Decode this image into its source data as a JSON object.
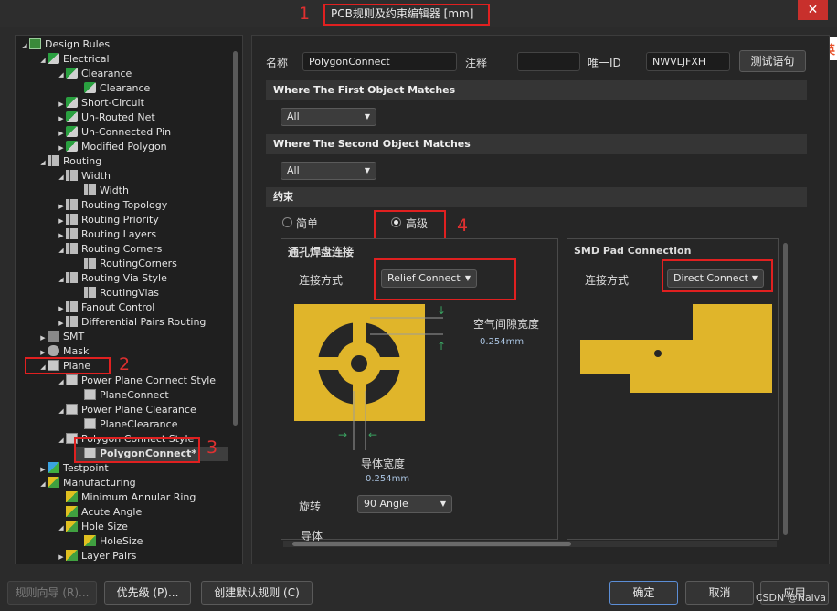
{
  "window": {
    "title": "PCB规则及约束编辑器 [mm]",
    "close_symbol": "✕",
    "annotations": [
      "1",
      "2",
      "3",
      "4"
    ],
    "ime_badge": {
      "logo": "S",
      "text": "英"
    }
  },
  "tree": [
    {
      "label": "Design Rules",
      "icon": "design-rules-icon",
      "expanded": true
    },
    {
      "label": "Electrical",
      "icon": "rule-category-icon",
      "expanded": true
    },
    {
      "label": "Clearance",
      "icon": "rule-icon",
      "expanded": true
    },
    {
      "label": "Clearance",
      "icon": "rule-icon"
    },
    {
      "label": "Short-Circuit",
      "icon": "rule-icon",
      "expanded": false
    },
    {
      "label": "Un-Routed Net",
      "icon": "rule-icon",
      "expanded": false
    },
    {
      "label": "Un-Connected Pin",
      "icon": "rule-icon",
      "expanded": false
    },
    {
      "label": "Modified Polygon",
      "icon": "rule-icon",
      "expanded": false
    },
    {
      "label": "Routing",
      "icon": "routing-icon",
      "expanded": true
    },
    {
      "label": "Width",
      "icon": "routing-icon",
      "expanded": true
    },
    {
      "label": "Width",
      "icon": "routing-icon"
    },
    {
      "label": "Routing Topology",
      "icon": "routing-icon",
      "expanded": false
    },
    {
      "label": "Routing Priority",
      "icon": "routing-icon",
      "expanded": false
    },
    {
      "label": "Routing Layers",
      "icon": "routing-icon",
      "expanded": false
    },
    {
      "label": "Routing Corners",
      "icon": "routing-icon",
      "expanded": true
    },
    {
      "label": "RoutingCorners",
      "icon": "routing-icon"
    },
    {
      "label": "Routing Via Style",
      "icon": "routing-icon",
      "expanded": true
    },
    {
      "label": "RoutingVias",
      "icon": "routing-icon"
    },
    {
      "label": "Fanout Control",
      "icon": "routing-icon",
      "expanded": false
    },
    {
      "label": "Differential Pairs Routing",
      "icon": "routing-icon",
      "expanded": false
    },
    {
      "label": "SMT",
      "icon": "smt-icon",
      "expanded": false
    },
    {
      "label": "Mask",
      "icon": "mask-icon",
      "expanded": false
    },
    {
      "label": "Plane",
      "icon": "plane-icon",
      "expanded": true
    },
    {
      "label": "Power Plane Connect Style",
      "icon": "plane-icon",
      "expanded": true
    },
    {
      "label": "PlaneConnect",
      "icon": "plane-icon"
    },
    {
      "label": "Power Plane Clearance",
      "icon": "plane-icon",
      "expanded": true
    },
    {
      "label": "PlaneClearance",
      "icon": "plane-icon"
    },
    {
      "label": "Polygon Connect Style",
      "icon": "plane-icon",
      "expanded": true
    },
    {
      "label": "PolygonConnect*",
      "icon": "plane-icon",
      "selected": true
    },
    {
      "label": "Testpoint",
      "icon": "testpoint-icon",
      "expanded": false
    },
    {
      "label": "Manufacturing",
      "icon": "manufacturing-icon",
      "expanded": true
    },
    {
      "label": "Minimum Annular Ring",
      "icon": "manufacturing-icon"
    },
    {
      "label": "Acute Angle",
      "icon": "manufacturing-icon"
    },
    {
      "label": "Hole Size",
      "icon": "manufacturing-icon",
      "expanded": true
    },
    {
      "label": "HoleSize",
      "icon": "manufacturing-icon"
    },
    {
      "label": "Layer Pairs",
      "icon": "manufacturing-icon",
      "expanded": false
    }
  ],
  "rule": {
    "name_label": "名称",
    "name_value": "PolygonConnect",
    "comment_label": "注释",
    "comment_value": "",
    "uid_label": "唯一ID",
    "uid_value": "NWVLJFXH",
    "test_button": "测试语句"
  },
  "first_match": {
    "header": "Where The First Object Matches",
    "value": "All"
  },
  "second_match": {
    "header": "Where The Second Object Matches",
    "value": "All"
  },
  "constraints": {
    "header": "约束",
    "mode_simple": "简单",
    "mode_advanced": "高级",
    "selected_mode": "advanced",
    "through_hole": {
      "title": "通孔焊盘连接",
      "connect_label": "连接方式",
      "connect_value": "Relief Connect",
      "air_gap_label": "空气间隙宽度",
      "air_gap_value": "0.254mm",
      "conductor_width_label": "导体宽度",
      "conductor_width_value": "0.254mm",
      "rotation_label": "旋转",
      "rotation_value": "90 Angle",
      "conductors_label": "导体"
    },
    "smd": {
      "title": "SMD Pad Connection",
      "connect_label": "连接方式",
      "connect_value": "Direct Connect"
    }
  },
  "buttons": {
    "rule_wizard": "规则向导 (R)...",
    "priorities": "优先级 (P)...",
    "create_default": "创建默认规则 (C)",
    "ok": "确定",
    "cancel": "取消",
    "apply": "应用"
  },
  "watermark": "CSDN @Naiva",
  "colors": {
    "copper": "#e0b52a",
    "highlight": "#e02020",
    "background": "#2b2b2b"
  }
}
